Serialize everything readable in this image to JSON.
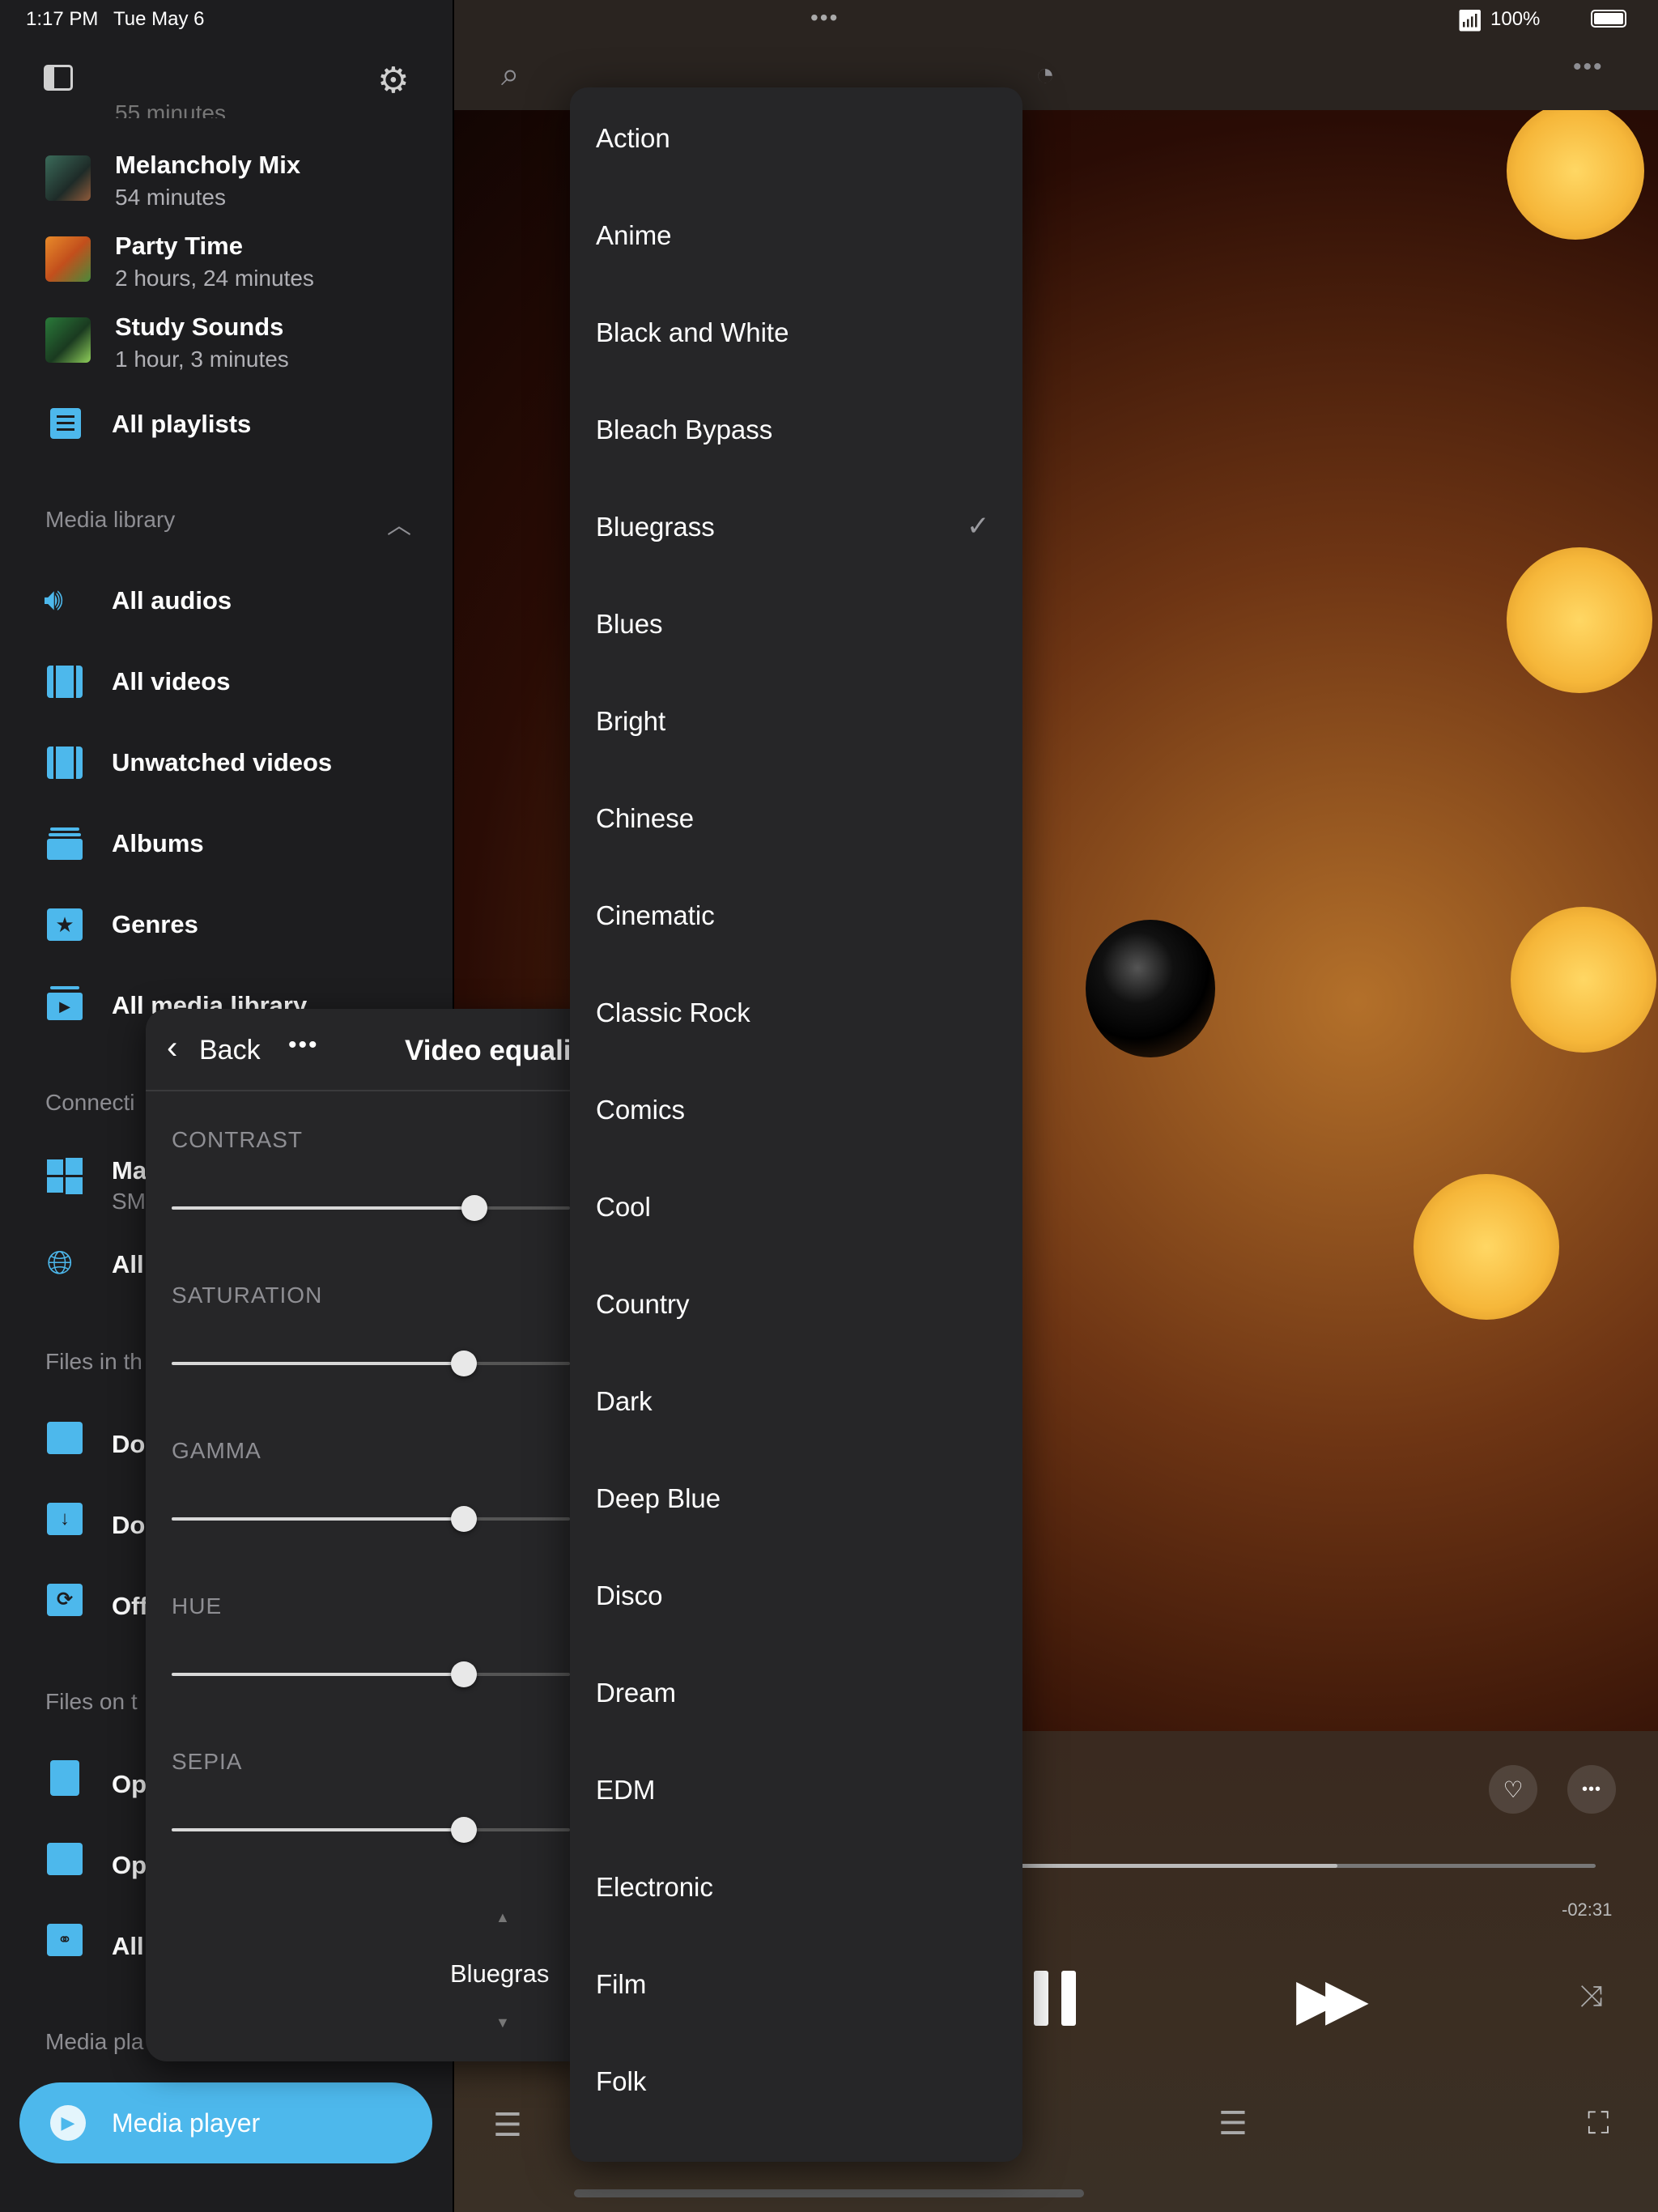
{
  "status_bar": {
    "time": "1:17 PM",
    "date": "Tue May 6",
    "battery": "100%"
  },
  "sidebar": {
    "truncated_top": "55 minutes",
    "playlists": [
      {
        "title": "Melancholy Mix",
        "subtitle": "54 minutes"
      },
      {
        "title": "Party Time",
        "subtitle": "2 hours, 24 minutes"
      },
      {
        "title": "Study Sounds",
        "subtitle": "1 hour, 3 minutes"
      }
    ],
    "all_playlists": "All playlists",
    "media_library_header": "Media library",
    "media_library": [
      "All audios",
      "All videos",
      "Unwatched videos",
      "Albums",
      "Genres",
      "All media library"
    ],
    "connections_header": "Connecti",
    "connections": [
      {
        "title": "Ma",
        "subtitle": "SM"
      },
      {
        "title": "All",
        "subtitle": ""
      }
    ],
    "files_in_header": "Files in th",
    "files_in": [
      "Do",
      "Do",
      "Off"
    ],
    "files_on_header": "Files on t",
    "files_on": [
      "Op",
      "Op",
      "All"
    ],
    "media_player_header": "Media pla",
    "media_player_button": "Media player"
  },
  "equalizer": {
    "back": "Back",
    "title": "Video equali",
    "sliders": [
      {
        "label": "CONTRAST",
        "value": 0.85
      },
      {
        "label": "SATURATION",
        "value": 0.82
      },
      {
        "label": "GAMMA",
        "value": 0.82
      },
      {
        "label": "HUE",
        "value": 0.82
      },
      {
        "label": "SEPIA",
        "value": 0.82
      }
    ],
    "preset": "Bluegras"
  },
  "menu": {
    "items": [
      "Action",
      "Anime",
      "Black and White",
      "Bleach Bypass",
      "Bluegrass",
      "Blues",
      "Bright",
      "Chinese",
      "Cinematic",
      "Classic Rock",
      "Comics",
      "Cool",
      "Country",
      "Dark",
      "Deep Blue",
      "Disco",
      "Dream",
      "EDM",
      "Electronic",
      "Film",
      "Folk"
    ],
    "selected": "Bluegrass"
  },
  "player": {
    "remaining": "-02:31",
    "progress": 0.55
  },
  "colors": {
    "accent": "#4db8ec",
    "sidebar_bg": "#1d1d1f",
    "menu_bg": "#262628"
  }
}
